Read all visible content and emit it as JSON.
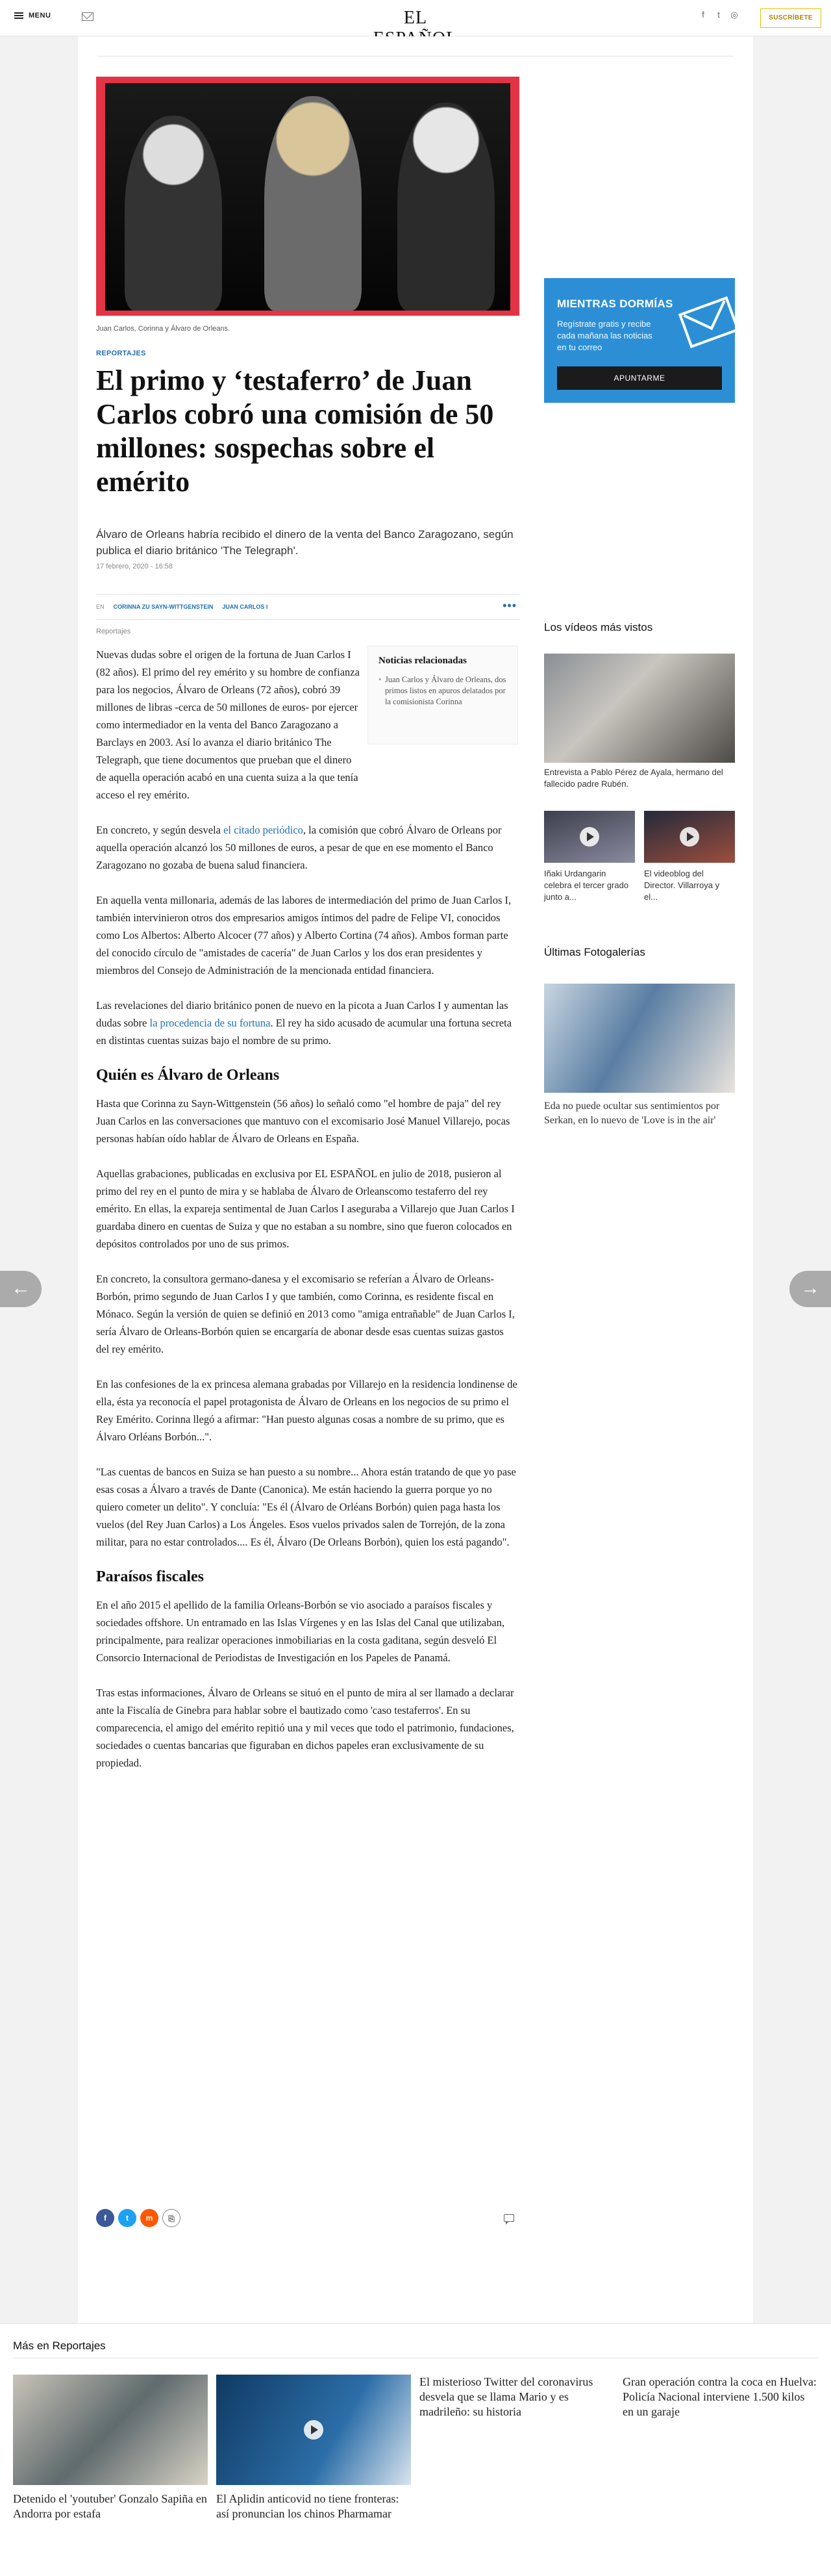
{
  "header": {
    "menu_label": "MENU",
    "logo": "EL ESPAÑOL",
    "subscribe_label": "SUSCRÍBETE",
    "social": [
      "f",
      "t",
      "◎"
    ]
  },
  "hero": {
    "caption": "Juan Carlos, Corinna y Álvaro de Orleans."
  },
  "article": {
    "section": "REPORTAJES",
    "headline": "El primo y ‘testaferro’ de Juan Carlos cobró una comisión de 50 millones: sospechas sobre el emérito",
    "subtitle": "Álvaro de Orleans habría recibido el dinero de la venta del Banco Zaragozano, según publica el diario británico 'The Telegraph'.",
    "date": "17 febrero, 2020 - 16:58",
    "tags_prefix": "EN",
    "tags": [
      "CORINNA ZU SAYN-WITTGENSTEIN",
      "JUAN CARLOS I"
    ],
    "label": "Reportajes",
    "related_title": "Noticias relacionadas",
    "related_item": "Juan Carlos y Álvaro de Orleans, dos primos listos en apuros delatados por la comisionista Corinna",
    "p1": "Nuevas dudas sobre el origen de la fortuna de Juan Carlos I (82 años). El primo del rey emérito y su hombre de confianza para los negocios, Álvaro de Orleans (72 años), cobró 39 millones de libras -cerca de 50 millones de euros- por ejercer como intermediador en la venta del Banco Zaragozano a Barclays en 2003. Así lo avanza el diario británico The Telegraph, que tiene documentos que prueban que el dinero de aquella operación acabó en una cuenta suiza a la que tenía acceso el rey emérito.",
    "p2_a": "En concreto, y según desvela ",
    "p2_link": "el citado periódico",
    "p2_b": ", la comisión que cobró Álvaro de Orleans por aquella operación alcanzó los 50 millones de euros, a pesar de que en ese momento el Banco Zaragozano no gozaba de buena salud financiera.",
    "p3": "En aquella venta millonaria, además de las labores de intermediación del primo de Juan Carlos I, también intervinieron otros dos empresarios amigos íntimos del padre de Felipe VI, conocidos como Los Albertos: Alberto Alcocer (77 años) y Alberto Cortina (74 años). Ambos forman parte del conocido círculo de \"amistades de cacería\" de Juan Carlos y los dos eran presidentes y miembros del Consejo de Administración de la mencionada entidad financiera.",
    "p4_a": "Las revelaciones del diario británico ponen de nuevo en la picota a Juan Carlos I y aumentan las dudas sobre ",
    "p4_link": "la procedencia de su fortuna",
    "p4_b": ". El rey ha sido acusado de acumular una fortuna secreta en distintas cuentas suizas bajo el nombre de su primo.",
    "h2_1": "Quién es Álvaro de Orleans",
    "p5": "Hasta que Corinna zu Sayn-Wittgenstein (56 años) lo señaló como \"el hombre de paja\" del rey Juan Carlos en las conversaciones que mantuvo con el excomisario José Manuel Villarejo, pocas personas habían oído hablar de Álvaro de Orleans en España.",
    "p6": "Aquellas grabaciones, publicadas en exclusiva por EL ESPAÑOL en julio de 2018, pusieron al primo del rey en el punto de mira y se hablaba de Álvaro de Orleanscomo testaferro del rey emérito. En ellas, la expareja sentimental de Juan Carlos I aseguraba a Villarejo que Juan Carlos I guardaba dinero en cuentas de Suiza y que no estaban a su nombre, sino que fueron colocados en depósitos controlados por uno de sus primos.",
    "p7": "En concreto, la consultora germano-danesa y el excomisario se referían a Álvaro de Orleans-Borbón, primo segundo de Juan Carlos I y que también, como Corinna, es residente fiscal en Mónaco. Según la versión de quien se definió en 2013 como \"amiga entrañable\" de Juan Carlos I, sería Álvaro de Orleans-Borbón quien se encargaría de abonar desde esas cuentas suizas gastos del rey emérito.",
    "p8": "En las confesiones de la ex princesa alemana grabadas por Villarejo en la residencia londinense de ella, ésta ya reconocía el papel protagonista de Álvaro de Orleans en los negocios de su primo el Rey Emérito. Corinna llegó a afirmar: \"Han puesto algunas cosas a nombre de su primo, que es Álvaro Orléans Borbón...\".",
    "p9": "\"Las cuentas de bancos en Suiza se han puesto a su nombre... Ahora están tratando de que yo pase esas cosas a Álvaro a través de Dante (Canonica). Me están haciendo la guerra porque yo no quiero cometer un delito\". Y concluía: \"Es él (Álvaro de Orléans Borbón) quien paga hasta los vuelos (del Rey Juan Carlos) a Los Ángeles. Esos vuelos privados salen de Torrejón, de la zona militar, para no estar controlados.... Es él, Álvaro (De Orleans Borbón), quien los está pagando\".",
    "h2_2": "Paraísos fiscales",
    "p10": "En el año 2015 el apellido de la familia Orleans-Borbón se vio asociado a paraísos fiscales y sociedades offshore. Un entramado en las Islas Vírgenes y en las Islas del Canal que utilizaban, principalmente, para realizar operaciones inmobiliarias en la costa gaditana, según desveló El Consorcio Internacional de Periodistas de Investigación en los Papeles de Panamá.",
    "p11": "Tras estas informaciones, Álvaro de Orleans se situó en el punto de mira al ser llamado a declarar ante la Fiscalía de Ginebra para hablar sobre el bautizado como 'caso testaferros'. En su comparecencia, el amigo del emérito repitió una y mil veces que todo el patrimonio, fundaciones, sociedades o cuentas bancarias que figuraban en dichos papeles eran exclusivamente de su propiedad."
  },
  "sidebar": {
    "newsletter_title": "MIENTRAS DORMÍAS",
    "newsletter_text": "Regístrate gratis y recibe cada mañana las noticias en tu correo",
    "newsletter_button": "APUNTARME",
    "videos_title": "Los vídeos más vistos",
    "video_main_caption": "Entrevista a Pablo Pérez de Ayala, hermano del fallecido padre Rubén.",
    "video_small_1": "Iñaki Urdangarin celebra el tercer grado junto a...",
    "video_small_2": "El videoblog del Director. Villarroya y el...",
    "photos_title": "Últimas Fotogalerías",
    "photo_caption": "Eda no puede ocultar sus sentimientos por Serkan, en lo nuevo de 'Love is in the air'"
  },
  "share": {
    "fb": "f",
    "tw": "t",
    "mn": "m",
    "ln": "⎘"
  },
  "more": {
    "title": "Más en Reportajes",
    "items": [
      "Detenido el 'youtuber' Gonzalo Sapiña en Andorra por estafa",
      "El Aplidin anticovid no tiene fronteras: así pronuncian los chinos Pharmamar",
      "El misterioso Twitter del coronavirus desvela que se llama Mario y es madrileño: su historia",
      "Gran operación contra la coca en Huelva: Policía Nacional interviene 1.500 kilos en un garaje"
    ]
  }
}
